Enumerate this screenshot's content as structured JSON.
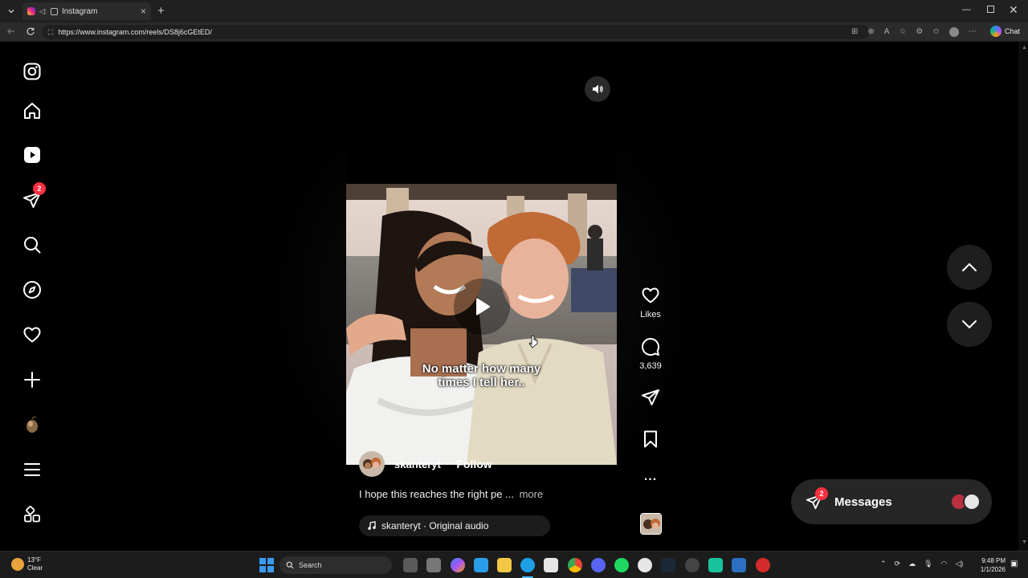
{
  "browser": {
    "tab_title": "Instagram",
    "url": "https://www.instagram.com/reels/DS8j6cGEtED/",
    "chat_label": "Chat",
    "new_tab_symbol": "+",
    "close_symbol": "×"
  },
  "sidebar": {
    "items": [
      {
        "name": "instagram-logo-icon"
      },
      {
        "name": "home-icon"
      },
      {
        "name": "reels-icon"
      },
      {
        "name": "messages-icon",
        "badge": "2"
      },
      {
        "name": "search-icon"
      },
      {
        "name": "explore-icon"
      },
      {
        "name": "notifications-icon"
      },
      {
        "name": "create-icon"
      },
      {
        "name": "profile-avatar"
      },
      {
        "name": "more-menu-icon"
      },
      {
        "name": "also-from-meta-icon"
      }
    ]
  },
  "reel": {
    "overlay_caption_line1": "No matter how many",
    "overlay_caption_line2": "times I tell her..",
    "author": "skanteryt",
    "separator": "•",
    "follow_label": "Follow",
    "description": "I hope this reaches the right pe ...",
    "more_label": "more",
    "audio": "skanteryt · Original audio"
  },
  "actions": {
    "likes_label": "Likes",
    "comments_count": "3,639",
    "more_symbol": "..."
  },
  "messages": {
    "label": "Messages",
    "badge": "2"
  },
  "taskbar": {
    "weather_temp": "13°F",
    "weather_cond": "Clear",
    "search_label": "Search",
    "time": "9:48 PM",
    "date": "1/1/2026"
  },
  "colors": {
    "badge": "#ff3040",
    "background": "#000000",
    "pill": "#262626"
  }
}
